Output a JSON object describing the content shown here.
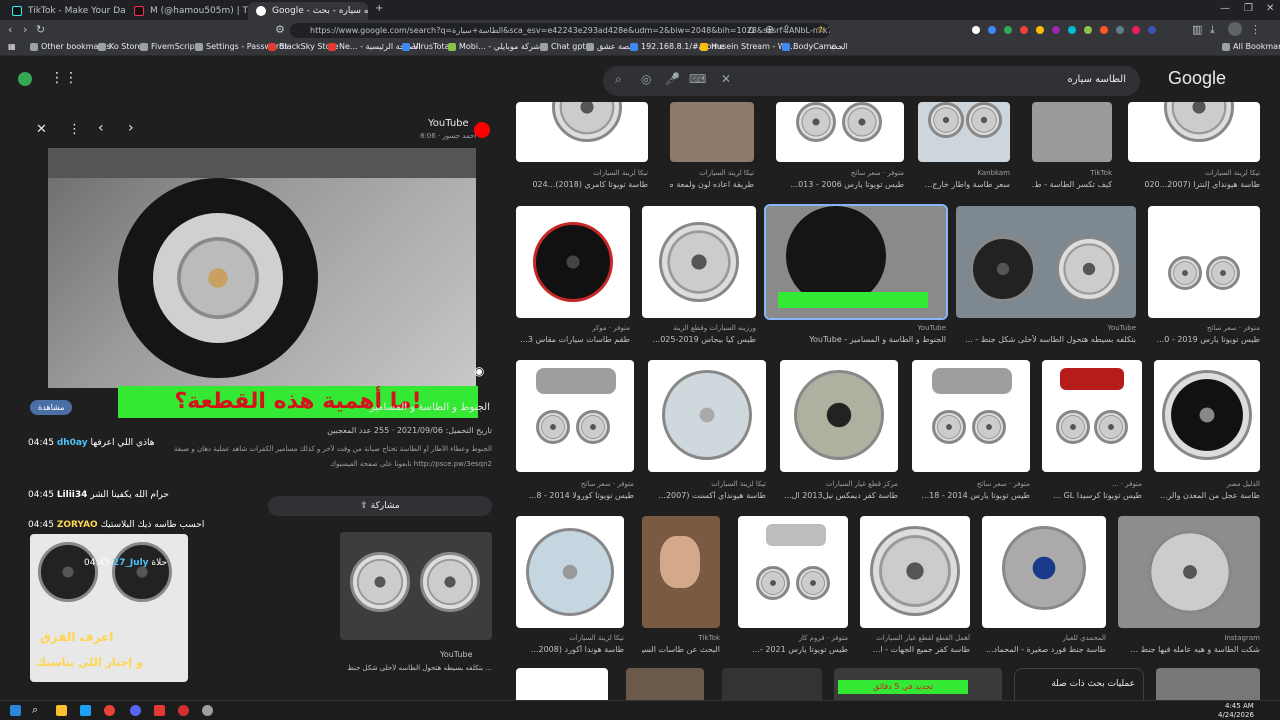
{
  "tabs": [
    {
      "title": "TikTok - Make Your Day",
      "color": "#111111"
    },
    {
      "title": "M (@hamou505m) | TikTok",
      "color": "#111111"
    },
    {
      "title": "Google - الطاسه سياره - بحث",
      "color": "#4285f4"
    }
  ],
  "address": {
    "url": "https://www.google.com/search?q=الطاسة+سيارة&sca_esv=e42243e293ad428e&udm=2&biw=2048&bih=1028&sxsrf=ANbL-n7k7PMfzl..."
  },
  "bookmarks": [
    "Other bookmarks",
    "Ko Store",
    "FivemScripts",
    "Settings - Passwords",
    "BlackSky Store",
    "Ne... - الصفحة الرئيسية",
    "VirusTotal",
    "Mobi... - شركة موبايلي",
    "Chat gpt",
    "قصة عشق",
    "192.168.8.1/#/home",
    "Husein Stream - Wa...",
    "BodyCame...",
    "الحب",
    "All Bookmarks"
  ],
  "search": {
    "query": "الطاسه سياره",
    "logo": "Google"
  },
  "panel": {
    "source": "YouTube",
    "author": "أحمد جسور · 8:06",
    "overlay_text": "ما أهمية هذه القطعة؟!",
    "title": "الجنوط و الطاسة و المسامير",
    "meta": "تاريخ التحميل: 2021/09/06 · 255 عدد المعجبين",
    "desc1": "الجنوط وعطاء الأطار أو الطاسة تحتاج صيانة من وقت لآخر و كذلك مسامير الكفرات شاهد عملية دهان و صبغة",
    "desc2": "تابعونا على صفحة الفيسبوك http://psce.pw/3esqn2",
    "share": "مشاركة",
    "view_btn": "مشاهدة",
    "related_source": "YouTube",
    "related_caption": "بتكلفه بسيطه هتحول الطاسه لأحلى شكل جنط ...",
    "related_overlay1": "اعرف الفرق",
    "related_overlay2": "و إختار اللي يناسبك"
  },
  "chat": [
    {
      "time": "04:45",
      "user": "dh0ay",
      "msg": "هاذي اللي اعرفها"
    },
    {
      "time": "04:45",
      "user": "Lilii34",
      "msg": "حرام الله يكفينا الشر"
    },
    {
      "time": "04:45",
      "user": "ZORYAO",
      "msg": "احسب طاسه ذيك البلاستيك"
    },
    {
      "time": "04:45",
      "user": "27_July",
      "msg": "حلاة"
    }
  ],
  "row1_captions": [
    {
      "cap": "طاسة تويوتا كامري (2018)...024",
      "src": "تيكا لزينة السيارات"
    },
    {
      "cap": "طريقة اعاده لون ولمعة طا...",
      "src": "تيكا لزينة السيارات"
    },
    {
      "cap": "طيس تويوتا يارس 2006 - 013...",
      "src": "متوفر · سعر سائح"
    },
    {
      "cap": "سعر طاسة واطار خارج...",
      "src": "Kanbkam"
    },
    {
      "cap": "كيف تكسر الطاسة - ط...",
      "src": "TikTok"
    },
    {
      "cap": "طاسة هيونداي إلنترا (2007...020",
      "src": "تيكا لزينة السيارات"
    }
  ],
  "row2_captions": [
    {
      "cap": "طقم طاسات سيارات مقاس 3...",
      "src": "متوفر · موكر"
    },
    {
      "cap": "طيس كيا بيجاس 2019-025...",
      "src": "ورزينه السيارات وقطع الزينة"
    },
    {
      "cap": "الجنوط و الطاسة و المسامير - YouTube",
      "src": "YouTube"
    },
    {
      "cap": "بتكلفه بسيطه هتحول الطاسه لأحلى شكل جنط - ...",
      "src": "YouTube"
    },
    {
      "cap": "طيس تويوتا يارس 2019 - 0...",
      "src": "متوفر · سعر سائح"
    }
  ],
  "row3_captions": [
    {
      "cap": "طيس تويوتا كورولا 2014 - 8...",
      "src": "متوفر · سعر سائح"
    },
    {
      "cap": "طاسة هيونداي أكسنت (2007...",
      "src": "تيكا لزينة السيارات"
    },
    {
      "cap": "طاسة كفر ديمكس نيل2013 ال...",
      "src": "مركز قطع غيار السيارات"
    },
    {
      "cap": "طيس تويوتا يارس 2014 - 18...",
      "src": "متوفر · سعر سائح"
    },
    {
      "cap": "طيس تويوتا كرسيدا GL ...",
      "src": "متوفر · ..."
    },
    {
      "cap": "طاسة عجل من المعدن والر...",
      "src": "الدليل مصر"
    }
  ],
  "row4_captions": [
    {
      "cap": "طاسة هوندا أكورد (2008...",
      "src": "تيكا لزينة السيارات"
    },
    {
      "cap": "البحث عن طاسات السيا...",
      "src": "TikTok"
    },
    {
      "cap": "طيس تويوتا يارس 2021 -...",
      "src": "متوفر · فروم كار"
    },
    {
      "cap": "طاسة كفر جميع الجهات - ا...",
      "src": "أهمل القطع لقطع غيار السيارات"
    },
    {
      "cap": "طاسة جنط فورد صغيرة - المحماد...",
      "src": "المحمدي للغيار"
    },
    {
      "cap": "شكت الطاسة و هيه عامله فيها جنط ...",
      "src": "Instagram"
    }
  ],
  "row5": {
    "new_text": "تجديد في 5 دقائق",
    "related": "عمليات بحث ذات صلة"
  },
  "clock": {
    "time": "4:45 AM",
    "date": "4/24/2026"
  }
}
